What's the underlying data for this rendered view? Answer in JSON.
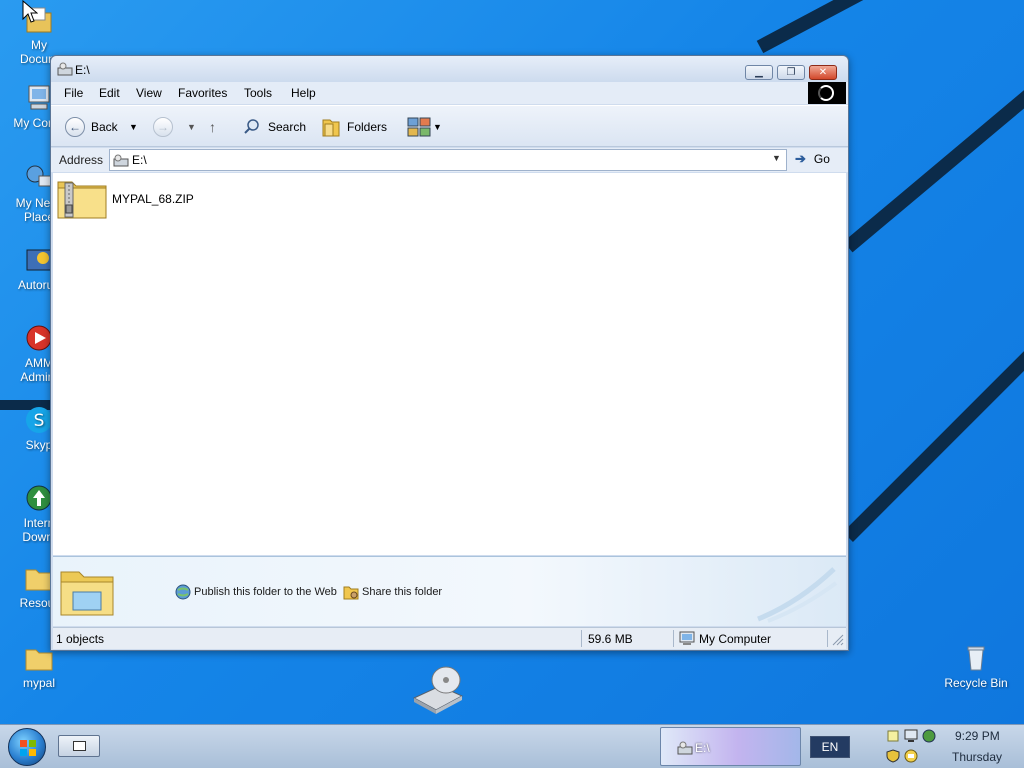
{
  "desktop": {
    "icons": [
      {
        "label": "My\nDocum"
      },
      {
        "label": "My Comp"
      },
      {
        "label": "My Netw\nPlace"
      },
      {
        "label": "Autorun"
      },
      {
        "label": "AMM\nAdmin."
      },
      {
        "label": "Skyp"
      },
      {
        "label": "Intern\nDownl"
      },
      {
        "label": "Resour"
      },
      {
        "label": "mypal"
      },
      {
        "label": "Recycle Bin"
      }
    ]
  },
  "window": {
    "title": "E:\\",
    "menu": [
      "File",
      "Edit",
      "View",
      "Favorites",
      "Tools",
      "Help"
    ],
    "toolbar": {
      "back_label": "Back",
      "search_label": "Search",
      "folders_label": "Folders"
    },
    "address": {
      "label": "Address",
      "value": "E:\\",
      "go_label": "Go"
    },
    "files": [
      {
        "name": "MYPAL_68.ZIP",
        "icon": "zip-folder-icon"
      }
    ],
    "taskpane": {
      "publish_label": "Publish this folder to the Web",
      "share_label": "Share this folder"
    },
    "status": {
      "objects": "1 objects",
      "size": "59.6 MB",
      "zone": "My Computer"
    }
  },
  "taskbar": {
    "task_label": "E:\\",
    "language": "EN",
    "time": "9:29 PM",
    "day": "Thursday"
  },
  "colors": {
    "desktop": "#1585e8",
    "window_chrome": "#cfdcee",
    "taskbar": "#b7cae0"
  }
}
